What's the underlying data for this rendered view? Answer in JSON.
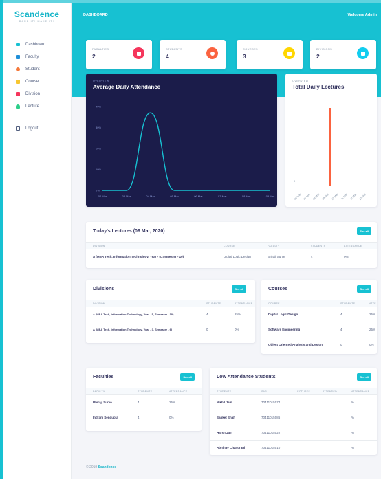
{
  "brand": {
    "name": "Scandence",
    "tagline": "DARE IT! MAKE IT!"
  },
  "sidebar": {
    "items": [
      {
        "label": "Dashboard",
        "color": "#17c1d2"
      },
      {
        "label": "Faculty",
        "color": "#1f8fd8"
      },
      {
        "label": "Student",
        "color": "#f5793b"
      },
      {
        "label": "Course",
        "color": "#f7c631"
      },
      {
        "label": "Division",
        "color": "#f5365c"
      },
      {
        "label": "Lecture",
        "color": "#2dce89"
      }
    ],
    "logout": "Logout"
  },
  "header": {
    "title": "DASHBOARD",
    "welcome": "Welcome Admin"
  },
  "stats": [
    {
      "label": "FACULTIES",
      "value": "2",
      "color": "#f5365c",
      "icon": "building-icon"
    },
    {
      "label": "STUDENTS",
      "value": "4",
      "color": "#fb6340",
      "icon": "users-icon"
    },
    {
      "label": "COURSES",
      "value": "3",
      "color": "#ffd600",
      "icon": "books-icon"
    },
    {
      "label": "DIVISIONS",
      "value": "2",
      "color": "#11cdef",
      "icon": "tablet-icon"
    }
  ],
  "attendance_chart": {
    "kicker": "OVERVIEW",
    "title": "Average Daily Attendance"
  },
  "lectures_chart": {
    "kicker": "OVERVIEW",
    "title": "Total Daily Lectures"
  },
  "chart_data": [
    {
      "type": "line",
      "title": "Average Daily Attendance",
      "x": [
        "02 Mar",
        "03 Mar",
        "04 Mar",
        "05 Mar",
        "06 Mar",
        "07 Mar",
        "08 Mar",
        "09 Mar"
      ],
      "y": [
        0,
        0,
        37,
        0,
        0,
        0,
        0,
        0
      ],
      "yticks": [
        "0%",
        "10%",
        "20%",
        "30%",
        "40%"
      ],
      "ylim": [
        0,
        40
      ],
      "color": "#17c1d2"
    },
    {
      "type": "bar",
      "title": "Total Daily Lectures",
      "categories": [
        "06 Mar",
        "07 Mar",
        "08 Mar",
        "09 Mar",
        "10 Mar",
        "11 Mar",
        "12 Mar",
        "13 Mar"
      ],
      "values": [
        0,
        0,
        0,
        1,
        0,
        0,
        0,
        0
      ],
      "yticks": [
        "0"
      ],
      "color": "#fb6340"
    }
  ],
  "today_lectures": {
    "title": "Today's Lectures (09 Mar, 2020)",
    "see_all": "See all",
    "columns": [
      "DIVISION",
      "COURSE",
      "FACULTY",
      "STUDENTS",
      "ATTENDANCE"
    ],
    "rows": [
      [
        "A (MBA Tech, Information Technology, Year - 5, Semester - 10)",
        "Digital Logic Design",
        "Bhiraji Surve",
        "4",
        "0%"
      ]
    ]
  },
  "divisions": {
    "title": "Divisions",
    "see_all": "See all",
    "columns": [
      "DIVISION",
      "STUDENTS",
      "ATTENDANCE"
    ],
    "rows": [
      [
        "A (MBA Tech, Information Technology, Year - 5, Semester - 10)",
        "4",
        "25%"
      ],
      [
        "A (MBA Tech, Information Technology, Year - 3, Semester - 6)",
        "0",
        "0%"
      ]
    ]
  },
  "courses": {
    "title": "Courses",
    "see_all": "See all",
    "columns": [
      "COURSE",
      "STUDENTS",
      "ATTE"
    ],
    "rows": [
      [
        "Digital Logic Design",
        "4",
        "25%"
      ],
      [
        "Software Engineering",
        "4",
        "25%"
      ],
      [
        "Object Oriented Analysis and Design",
        "0",
        "0%"
      ]
    ]
  },
  "faculties": {
    "title": "Faculties",
    "see_all": "See all",
    "columns": [
      "FACULTY",
      "STUDENTS",
      "ATTENDANCE"
    ],
    "rows": [
      [
        "Bhiraji Surve",
        "4",
        "25%"
      ],
      [
        "Indrani Sengupta",
        "4",
        "0%"
      ]
    ]
  },
  "low_attendance": {
    "title": "Low Attendance Students",
    "see_all": "See all",
    "columns": [
      "STUDENTS",
      "SAP",
      "LECTURES",
      "ATTENDED",
      "ATTENDANCE"
    ],
    "rows": [
      [
        "Nikhil Jain",
        "70411015074",
        "%"
      ],
      [
        "Sanket Shah",
        "70411015086",
        "%"
      ],
      [
        "Harsh Jain",
        "70411015022",
        "%"
      ],
      [
        "Abhinav Chandrani",
        "70411015010",
        "%"
      ]
    ]
  },
  "footer": {
    "copyright": "© 2019",
    "brand": "Scandence"
  }
}
